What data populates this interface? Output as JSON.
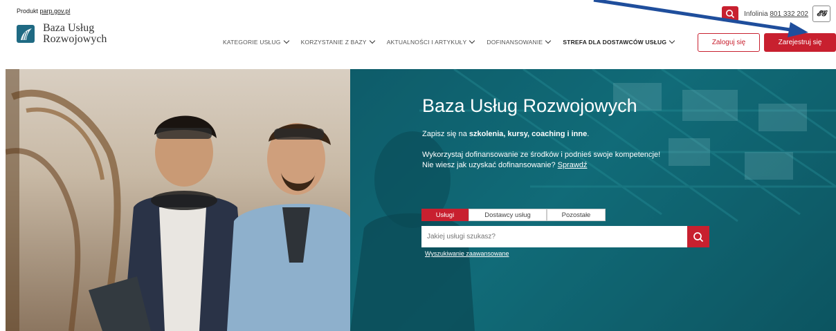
{
  "header": {
    "product_prefix": "Produkt ",
    "product_link": "parp.gov.pl",
    "logo_line1": "Baza Usług",
    "logo_line2": "Rozwojowych",
    "infolinia_label": "Infolinia ",
    "infolinia_number": "801 332 202"
  },
  "nav": {
    "items": [
      {
        "label": "KATEGORIE USŁUG"
      },
      {
        "label": "KORZYSTANIE Z BAZY"
      },
      {
        "label": "AKTUALNOŚCI I ARTYKUŁY"
      },
      {
        "label": "DOFINANSOWANIE"
      },
      {
        "label": "STREFA DLA DOSTAWCÓW USŁUG"
      }
    ],
    "login_label": "Zaloguj się",
    "register_label": "Zarejestruj się"
  },
  "hero": {
    "title": "Baza Usług Rozwojowych",
    "sub_prefix": "Zapisz się na ",
    "sub_bold": "szkolenia, kursy, coaching i inne",
    "sub_suffix": ".",
    "p1": "Wykorzystaj dofinansowanie ze środków i podnieś swoje kompetencje!",
    "p2_prefix": "Nie wiesz jak uzyskać dofinansowanie? ",
    "p2_link": "Sprawdź",
    "tabs": [
      {
        "label": "Usługi",
        "active": true
      },
      {
        "label": "Dostawcy usług",
        "active": false
      },
      {
        "label": "Pozostałe",
        "active": false
      }
    ],
    "search_placeholder": "Jakiej usługi szukasz?",
    "advanced_link": "Wyszukiwanie zaawansowane"
  },
  "colors": {
    "brand_red": "#c8202f",
    "hero_teal": "#137380",
    "logo_blue": "#1f6a83",
    "annotation_arrow": "#1f4e9c"
  },
  "icons": [
    "search-icon",
    "sign-language-icon",
    "chevron-down-icon",
    "logo-leaf-icon"
  ]
}
